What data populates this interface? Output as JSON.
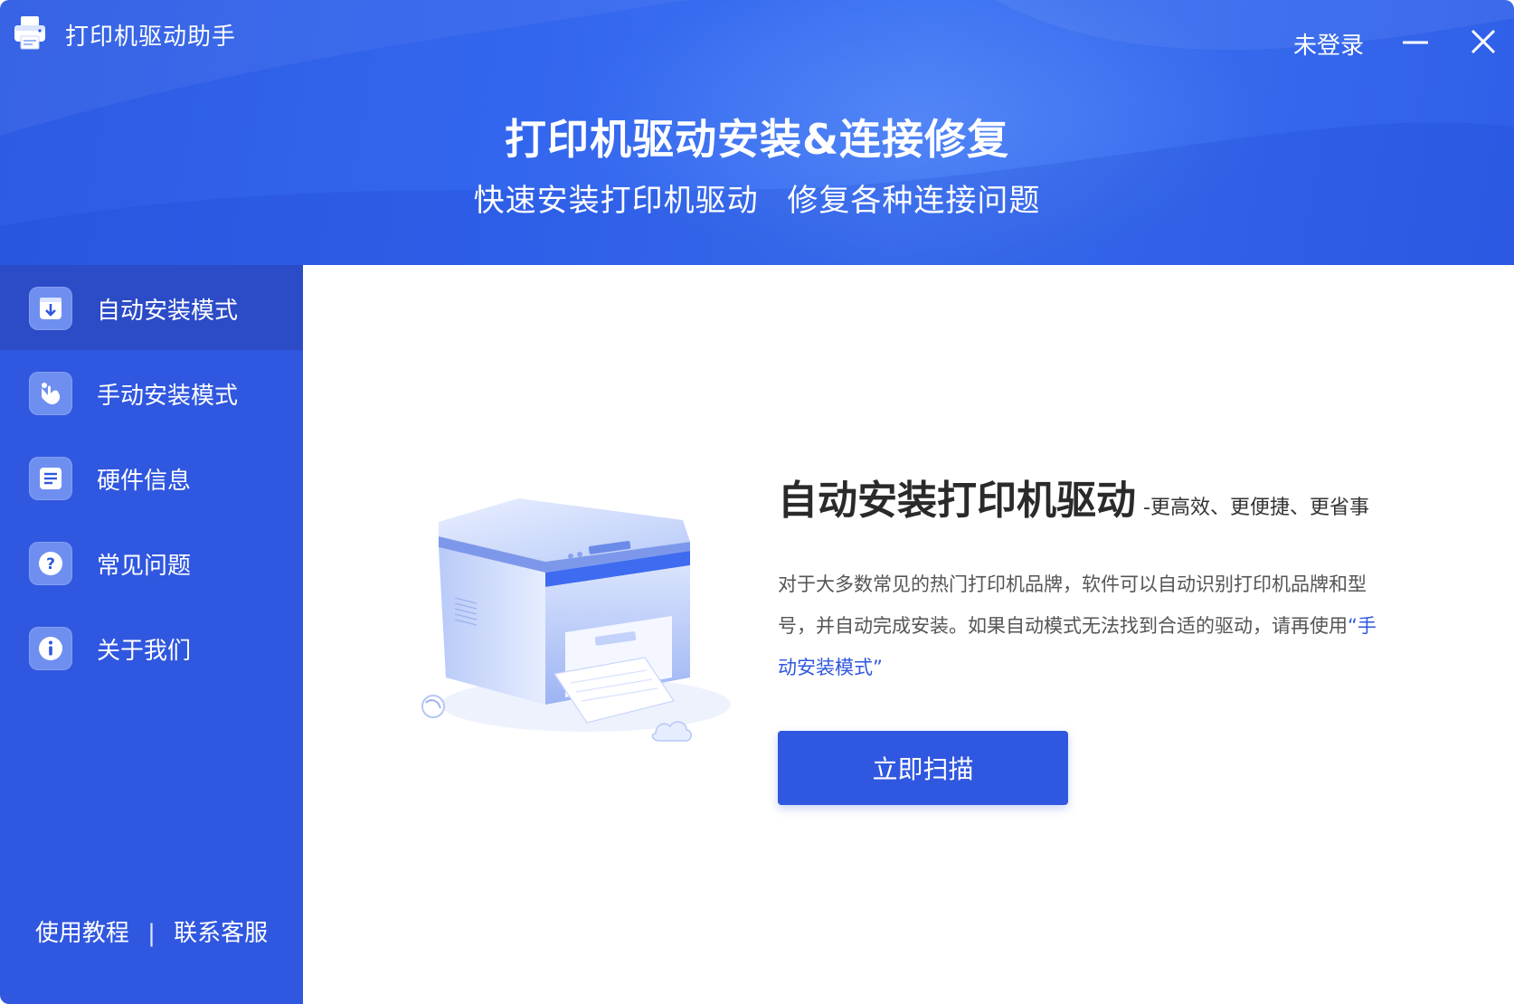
{
  "window": {
    "title": "打印机驱动助手",
    "login_label": "未登录"
  },
  "hero": {
    "title": "打印机驱动安装&连接修复",
    "subtitle": "快速安装打印机驱动  修复各种连接问题"
  },
  "sidebar": {
    "items": [
      {
        "label": "自动安装模式",
        "icon": "download-icon",
        "active": true
      },
      {
        "label": "手动安装模式",
        "icon": "hand-icon",
        "active": false
      },
      {
        "label": "硬件信息",
        "icon": "list-icon",
        "active": false
      },
      {
        "label": "常见问题",
        "icon": "question-icon",
        "active": false
      },
      {
        "label": "关于我们",
        "icon": "info-icon",
        "active": false
      }
    ],
    "footer": {
      "tutorial": "使用教程",
      "separator": "|",
      "support": "联系客服"
    }
  },
  "main": {
    "title": "自动安装打印机驱动",
    "tagline": "-更高效、更便捷、更省事",
    "description": "对于大多数常见的热门打印机品牌，软件可以自动识别打印机品牌和型号，并自动完成安装。如果自动模式无法找到合适的驱动，请再使用",
    "description_link": "“手动安装模式”",
    "scan_button": "立即扫描"
  },
  "colors": {
    "primary": "#3057df",
    "sidebar_active": "#2c4bc6",
    "header_gradient_start": "#2d5be3",
    "header_gradient_end": "#3d72f2"
  }
}
